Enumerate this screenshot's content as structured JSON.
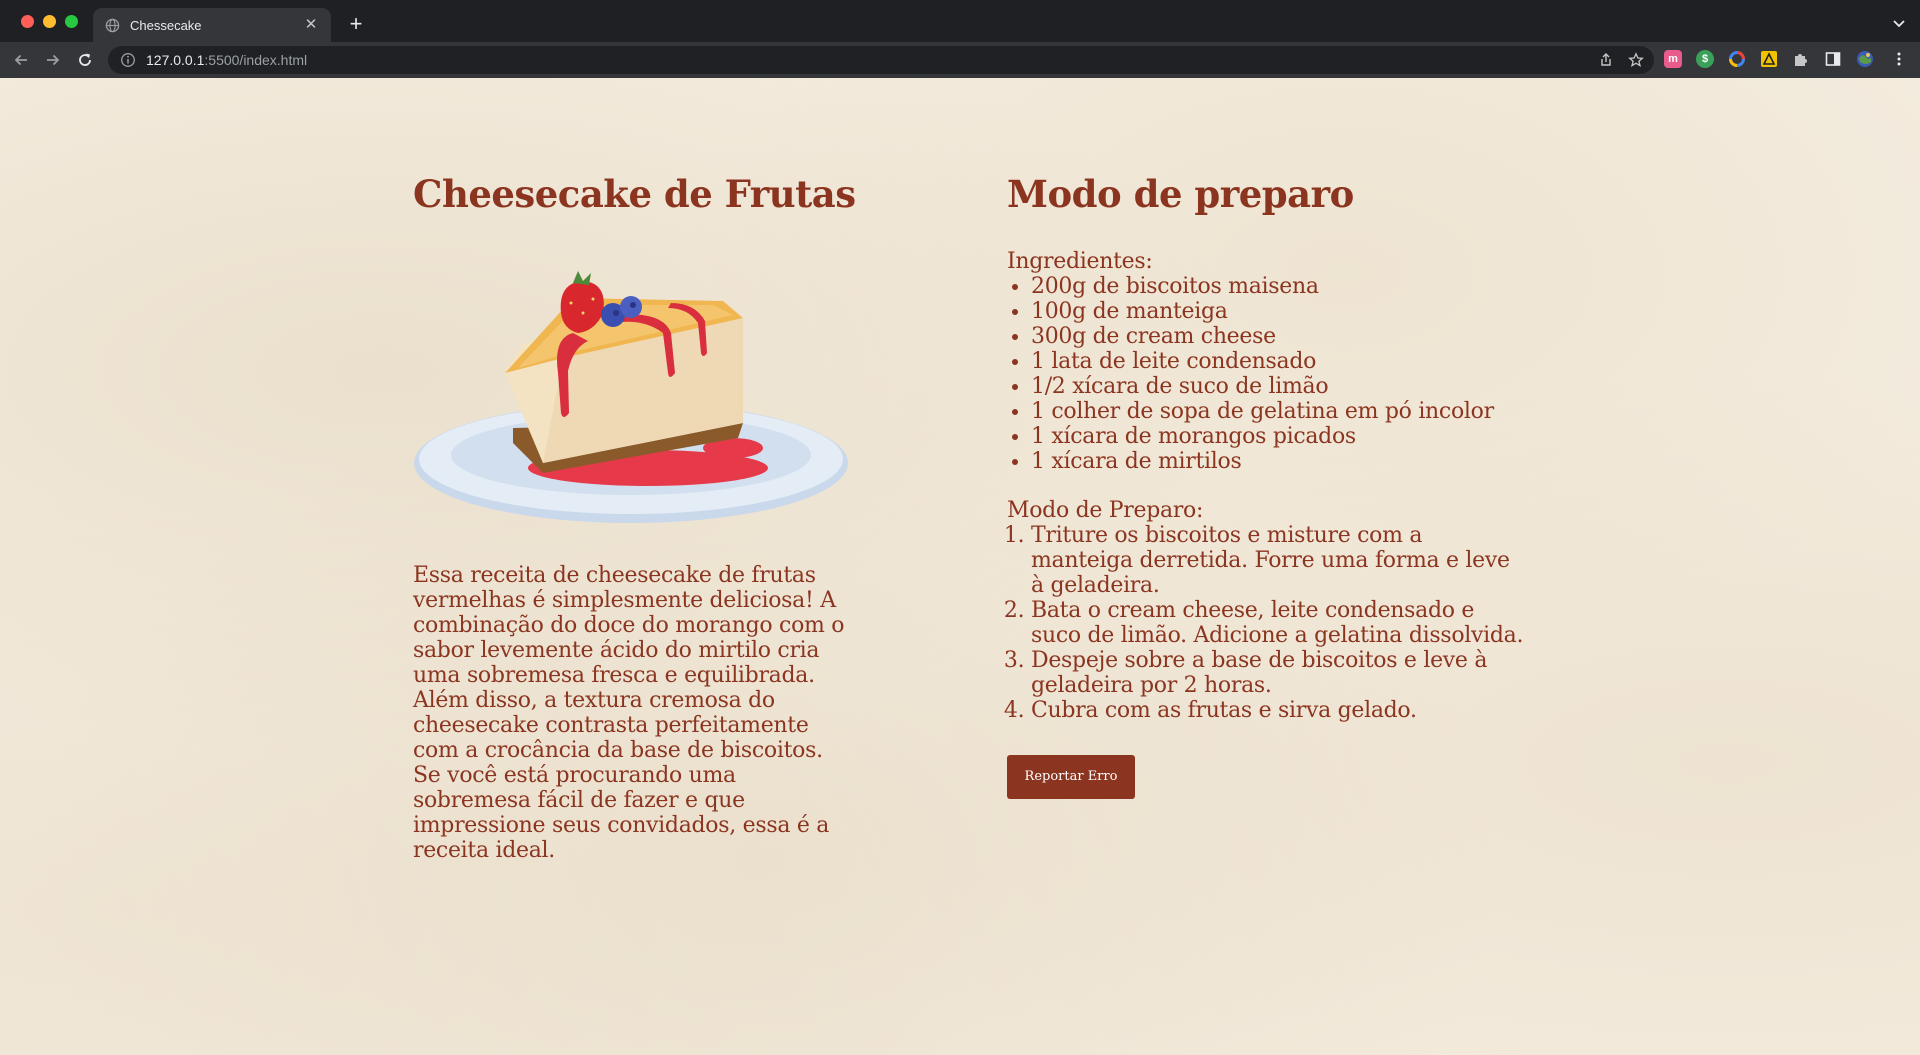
{
  "browser": {
    "tab_title": "Chessecake",
    "new_tab_symbol": "+",
    "close_symbol": "✕",
    "url_host": "127.0.0.1",
    "url_path": ":5500/index.html"
  },
  "extensions": [
    {
      "name": "m-extension-icon",
      "letter": "m",
      "color": "#e85b8a"
    },
    {
      "name": "dollar-extension-icon",
      "letter": "$",
      "color": "#3aa05a"
    },
    {
      "name": "ring-extension-icon",
      "letter": "",
      "color": "#4285f4"
    },
    {
      "name": "warning-extension-icon",
      "letter": "",
      "color": "#f2c200"
    }
  ],
  "recipe": {
    "title": "Cheesecake de Frutas",
    "image_alt": "fatia de cheesecake com morango e mirtilos",
    "description": "Essa receita de cheesecake de frutas vermelhas é simplesmente deliciosa! A combinação do doce do morango com o sabor levemente ácido do mirtilo cria uma sobremesa fresca e equilibrada. Além disso, a textura cremosa do cheesecake contrasta perfeitamente com a crocância da base de biscoitos. Se você está procurando uma sobremesa fácil de fazer e que impressione seus convidados, essa é a receita ideal."
  },
  "preparation": {
    "title": "Modo de preparo",
    "ingredients_label": "Ingredientes:",
    "ingredients": [
      "200g de biscoitos maisena",
      "100g de manteiga",
      "300g de cream cheese",
      "1 lata de leite condensado",
      "1/2 xícara de suco de limão",
      "1 colher de sopa de gelatina em pó incolor",
      "1 xícara de morangos picados",
      "1 xícara de mirtilos"
    ],
    "steps_label": "Modo de Preparo:",
    "steps": [
      "Triture os biscoitos e misture com a manteiga derretida. Forre uma forma e leve à geladeira.",
      "Bata o cream cheese, leite condensado e suco de limão. Adicione a gelatina dissolvida.",
      "Despeje sobre a base de biscoitos e leve à geladeira por 2 horas.",
      "Cubra com as frutas e sirva gelado."
    ],
    "report_button": "Reportar Erro"
  },
  "colors": {
    "accent": "#8b3520",
    "page_background": "#f3ebdd"
  }
}
